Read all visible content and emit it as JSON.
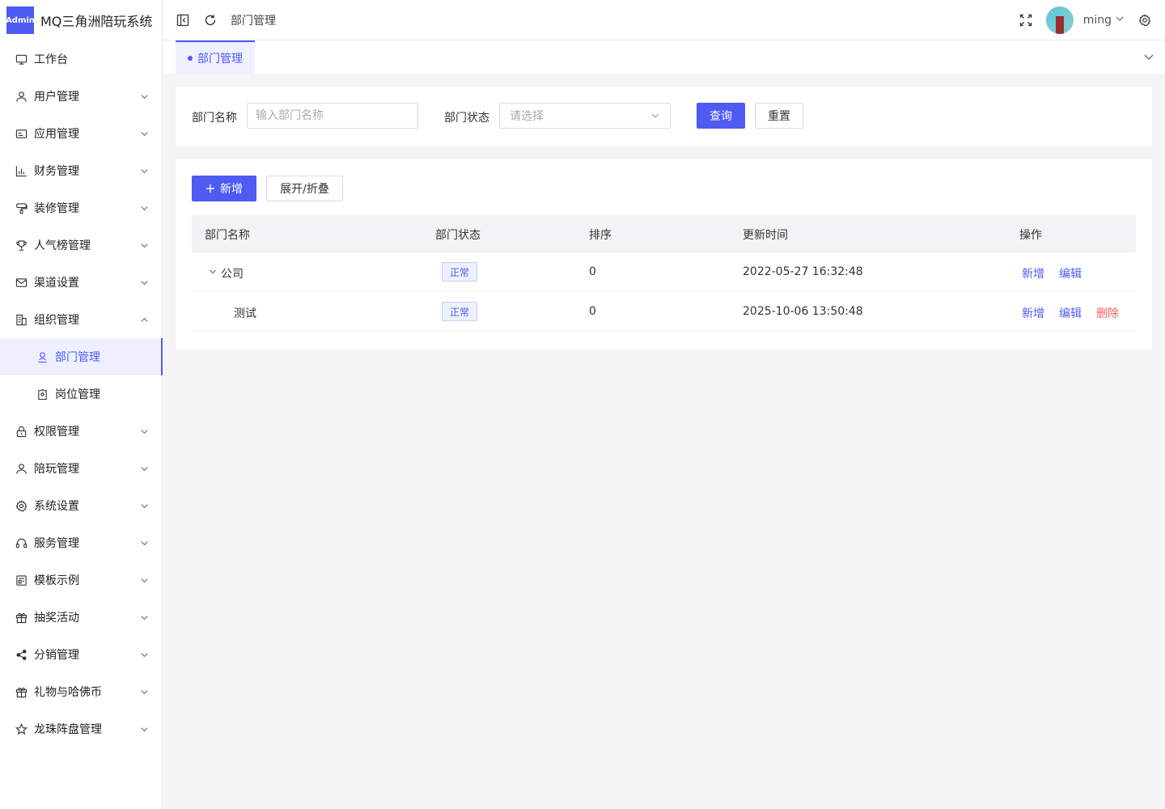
{
  "logo": {
    "badge": "Admin",
    "title": "MQ三角洲陪玩系统"
  },
  "sidebar": {
    "items": [
      {
        "name": "workbench",
        "label": "工作台",
        "icon": "monitor-icon",
        "arrow": ""
      },
      {
        "name": "user",
        "label": "用户管理",
        "icon": "user-icon",
        "arrow": "down"
      },
      {
        "name": "app",
        "label": "应用管理",
        "icon": "app-icon",
        "arrow": "down"
      },
      {
        "name": "finance",
        "label": "财务管理",
        "icon": "chart-icon",
        "arrow": "down"
      },
      {
        "name": "decor",
        "label": "装修管理",
        "icon": "paint-icon",
        "arrow": "down"
      },
      {
        "name": "ranking",
        "label": "人气榜管理",
        "icon": "trophy-icon",
        "arrow": "down"
      },
      {
        "name": "channel",
        "label": "渠道设置",
        "icon": "mail-icon",
        "arrow": "down"
      },
      {
        "name": "org",
        "label": "组织管理",
        "icon": "building-icon",
        "arrow": "up"
      },
      {
        "name": "dept",
        "label": "部门管理",
        "icon": "person-icon",
        "arrow": "",
        "sub": true,
        "active": true
      },
      {
        "name": "post",
        "label": "岗位管理",
        "icon": "badge-icon",
        "arrow": "",
        "sub": true
      },
      {
        "name": "perm",
        "label": "权限管理",
        "icon": "lock-icon",
        "arrow": "down"
      },
      {
        "name": "companion",
        "label": "陪玩管理",
        "icon": "user-icon",
        "arrow": "down"
      },
      {
        "name": "system",
        "label": "系统设置",
        "icon": "gear-icon",
        "arrow": "down"
      },
      {
        "name": "service",
        "label": "服务管理",
        "icon": "headset-icon",
        "arrow": "down"
      },
      {
        "name": "template",
        "label": "模板示例",
        "icon": "template-icon",
        "arrow": "down"
      },
      {
        "name": "lottery",
        "label": "抽奖活动",
        "icon": "gift-icon",
        "arrow": "down"
      },
      {
        "name": "distribution",
        "label": "分销管理",
        "icon": "share-icon",
        "arrow": "down"
      },
      {
        "name": "gift",
        "label": "礼物与哈佛币",
        "icon": "gift-icon",
        "arrow": "down"
      },
      {
        "name": "dragonball",
        "label": "龙珠阵盘管理",
        "icon": "star-icon",
        "arrow": "down"
      }
    ]
  },
  "header": {
    "breadcrumb": "部门管理",
    "username": "ming"
  },
  "tabs": [
    {
      "label": "部门管理"
    }
  ],
  "search": {
    "dept_name_label": "部门名称",
    "dept_name_placeholder": "输入部门名称",
    "dept_status_label": "部门状态",
    "dept_status_placeholder": "请选择",
    "query_label": "查询",
    "reset_label": "重置"
  },
  "toolbar": {
    "add_label": "新增",
    "toggle_label": "展开/折叠"
  },
  "table": {
    "columns": [
      "部门名称",
      "部门状态",
      "排序",
      "更新时间",
      "操作"
    ],
    "rows": [
      {
        "name": "公司",
        "status": "正常",
        "sort": "0",
        "updated": "2022-05-27 16:32:48",
        "actions": [
          "新增",
          "编辑"
        ]
      },
      {
        "name": "测试",
        "status": "正常",
        "sort": "0",
        "updated": "2025-10-06 13:50:48",
        "actions": [
          "新增",
          "编辑",
          "删除"
        ]
      }
    ]
  },
  "colors": {
    "primary": "#4e5bf2",
    "danger": "#f25d5d"
  }
}
